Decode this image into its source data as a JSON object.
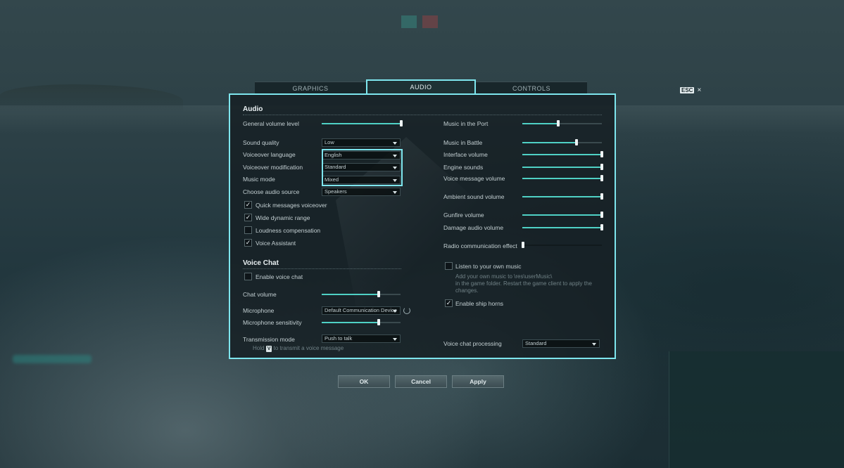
{
  "tabs": {
    "graphics": "GRAPHICS",
    "audio": "AUDIO",
    "controls": "CONTROLS"
  },
  "esc": {
    "key": "ESC",
    "close": "×"
  },
  "audio": {
    "title": "Audio",
    "general_volume": {
      "label": "General volume level",
      "value": 0.98
    },
    "sound_quality": {
      "label": "Sound quality",
      "value": "Low"
    },
    "voiceover_language": {
      "label": "Voiceover language",
      "value": "English"
    },
    "voiceover_modification": {
      "label": "Voiceover modification",
      "value": "Standard"
    },
    "music_mode": {
      "label": "Music mode",
      "value": "Mixed"
    },
    "audio_source": {
      "label": "Choose audio source",
      "value": "Speakers"
    },
    "checkboxes": [
      {
        "label": "Quick messages voiceover",
        "checked": true,
        "mark": "✓"
      },
      {
        "label": "Wide dynamic range",
        "checked": true,
        "mark": "✓"
      },
      {
        "label": "Loudness compensation",
        "checked": false,
        "mark": ""
      },
      {
        "label": "Voice Assistant",
        "checked": true,
        "mark": "✓"
      }
    ],
    "right_sliders": [
      {
        "label": "Music in the Port",
        "value": 0.45
      },
      {
        "label": "Music in Battle",
        "value": 0.68
      },
      {
        "label": "Interface volume",
        "value": 1.0
      },
      {
        "label": "Engine sounds",
        "value": 1.0
      },
      {
        "label": "Voice message volume",
        "value": 1.0
      },
      {
        "label": "Ambient sound volume",
        "value": 1.0
      },
      {
        "label": "Gunfire volume",
        "value": 1.0
      },
      {
        "label": "Damage audio volume",
        "value": 1.0
      },
      {
        "label": "Radio communication effect",
        "value": 0.0
      }
    ],
    "listen_music": {
      "label": "Listen to your own music",
      "checked": false,
      "mark": "",
      "hint1": "Add your own music to \\res\\userMusic\\",
      "hint2": "in the game folder. Restart the game client to apply the",
      "hint3": "changes."
    },
    "ship_horns": {
      "label": "Enable ship horns",
      "checked": true,
      "mark": "✓"
    },
    "voice_processing": {
      "label": "Voice chat processing",
      "value": "Standard"
    }
  },
  "voice_chat": {
    "title": "Voice Chat",
    "enable": {
      "label": "Enable voice chat",
      "checked": false,
      "mark": ""
    },
    "chat_volume": {
      "label": "Chat volume",
      "value": 0.7
    },
    "microphone": {
      "label": "Microphone",
      "value": "Default Communication Device"
    },
    "mic_sensitivity": {
      "label": "Microphone sensitivity",
      "value": 0.7
    },
    "transmission": {
      "label": "Transmission mode",
      "value": "Push to talk"
    },
    "hint_hold": "Hold",
    "hint_key": "V",
    "hint_rest": "to transmit a voice message"
  },
  "buttons": {
    "ok": "OK",
    "cancel": "Cancel",
    "apply": "Apply"
  },
  "colors": {
    "accent": "#7ee6ee",
    "slider_fill": "#4fd1c5"
  }
}
